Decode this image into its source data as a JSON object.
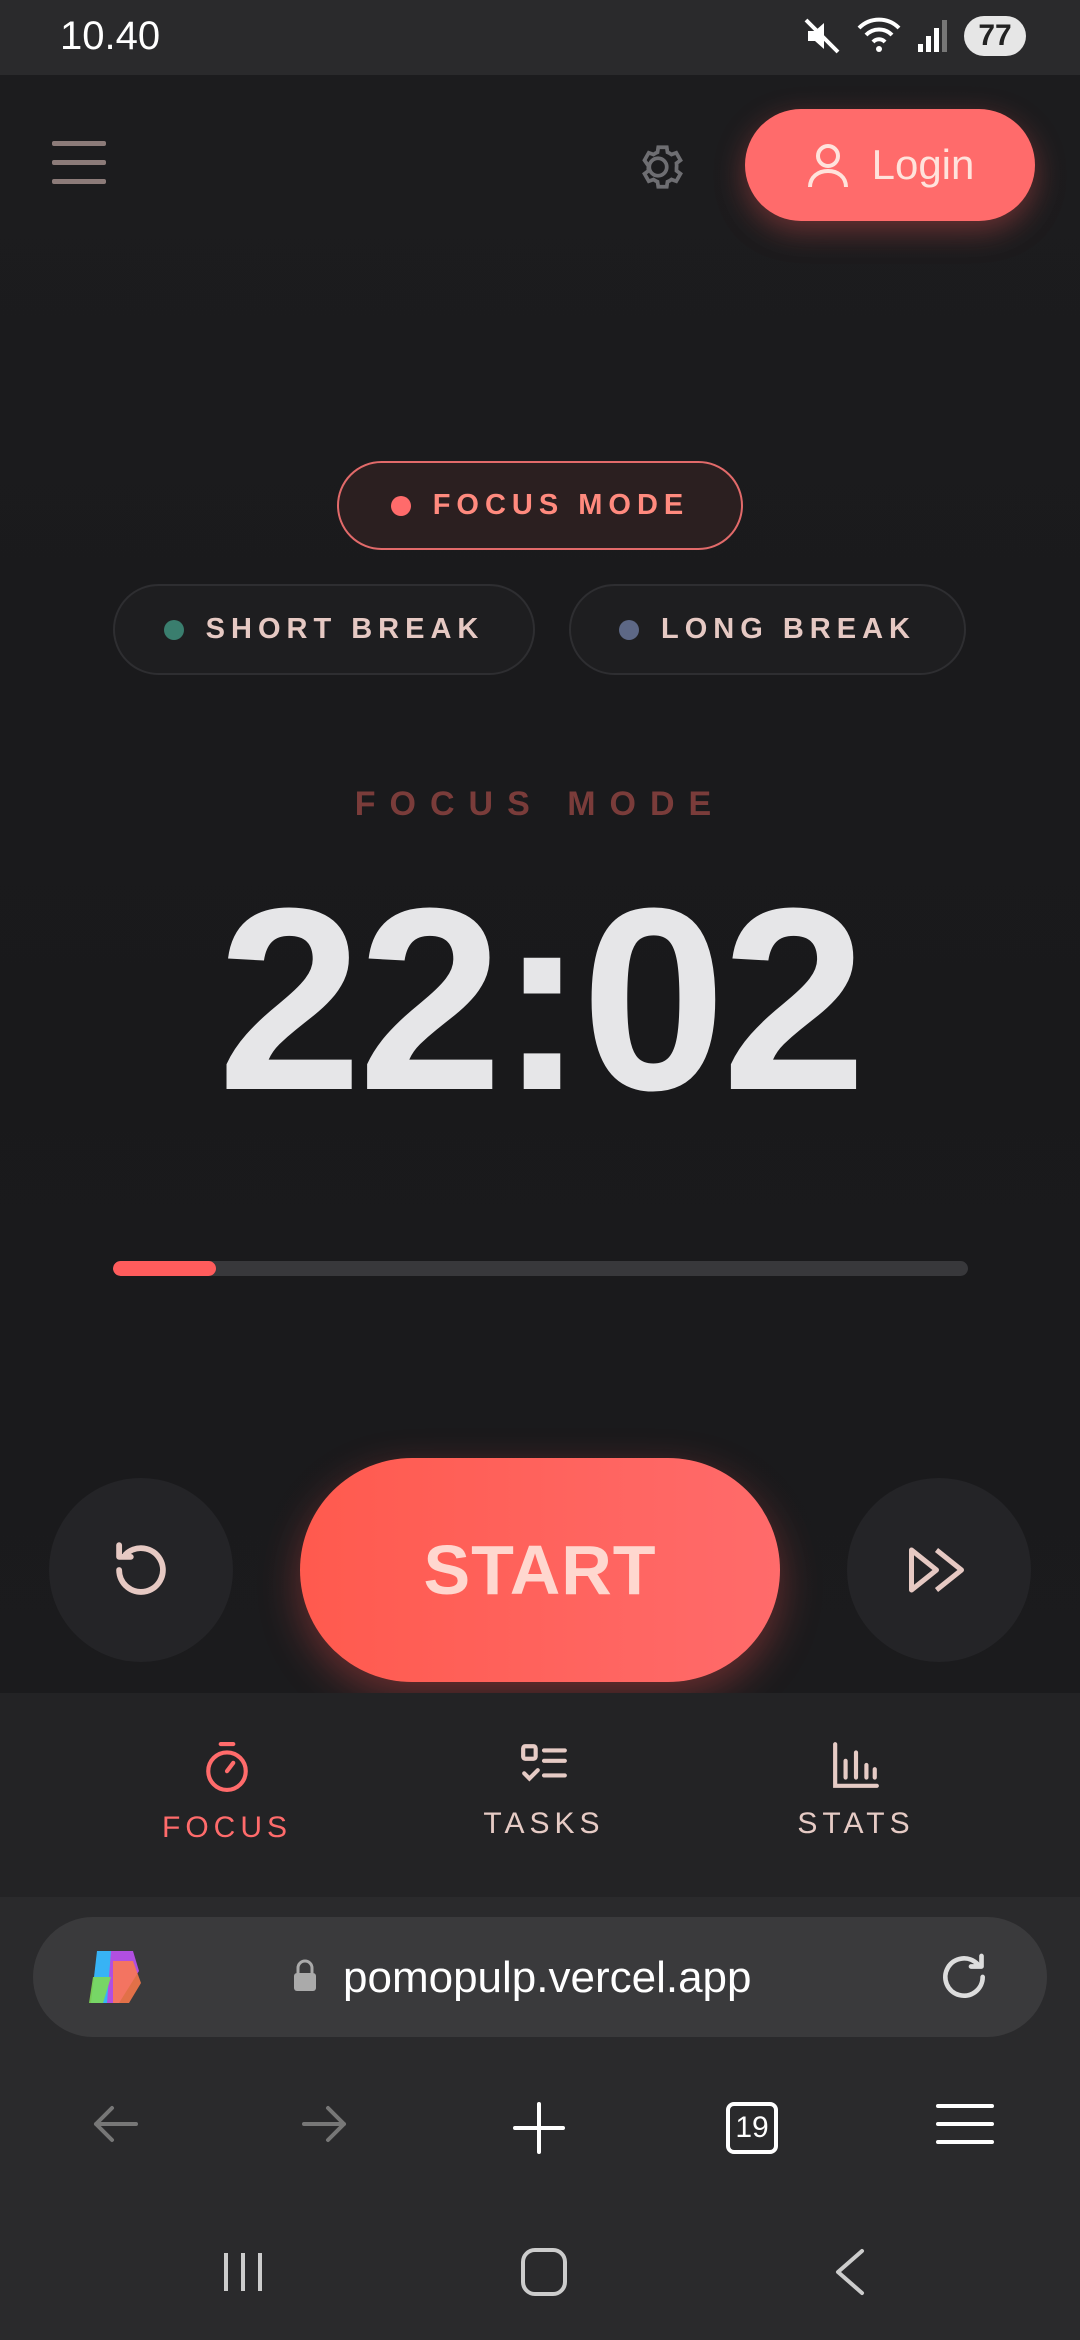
{
  "status_bar": {
    "time": "10.40",
    "battery": "77"
  },
  "header": {
    "login_label": "Login"
  },
  "modes": {
    "focus": {
      "label": "FOCUS MODE",
      "dot_color": "#ff6b6b"
    },
    "short_break": {
      "label": "SHORT BREAK",
      "dot_color": "#3a7e6e"
    },
    "long_break": {
      "label": "LONG BREAK",
      "dot_color": "#5d6886"
    }
  },
  "timer": {
    "mode_label": "FOCUS MODE",
    "time": "22:02",
    "progress": 0.12
  },
  "controls": {
    "start_label": "START"
  },
  "bottom_nav": {
    "items": [
      {
        "label": "FOCUS",
        "icon": "stopwatch-icon",
        "active": true
      },
      {
        "label": "TASKS",
        "icon": "checklist-icon",
        "active": false
      },
      {
        "label": "STATS",
        "icon": "bar-chart-icon",
        "active": false
      }
    ]
  },
  "browser": {
    "url": "pomopulp.vercel.app",
    "tab_count": "19"
  },
  "colors": {
    "accent": "#ff6b6b",
    "background": "#1b1b1d"
  }
}
